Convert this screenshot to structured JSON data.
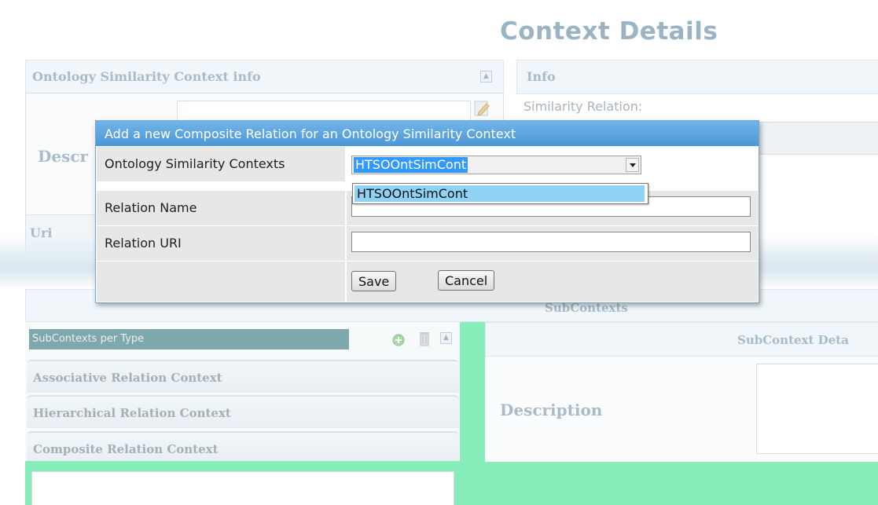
{
  "page": {
    "title": "Context Details",
    "left_panel_header": "Ontology Similarity Context info",
    "description_label": "Descr",
    "uri_label": "Uri",
    "right_panel_header": "Info",
    "similarity_relation_label": "Similarity Relation:",
    "subcontexts_header": "SubContexts"
  },
  "subcontexts": {
    "bar_label": "SubContexts per Type",
    "items": [
      {
        "label": "Associative Relation Context"
      },
      {
        "label": "Hierarchical Relation Context"
      },
      {
        "label": "Composite Relation Context"
      }
    ],
    "detail_header": "SubContext Deta",
    "detail_description_label": "Description"
  },
  "dialog": {
    "title": "Add a new Composite Relation for an Ontology Similarity Context",
    "fields": {
      "contexts_label": "Ontology Similarity Contexts",
      "contexts_selected": "HTSOOntSimCont",
      "contexts_options": [
        "HTSOOntSimCont"
      ],
      "relation_name_label": "Relation Name",
      "relation_name_value": "",
      "relation_uri_label": "Relation URI",
      "relation_uri_value": ""
    },
    "save_label": "Save",
    "cancel_label": "Cancel"
  },
  "colors": {
    "accent_green": "#86edbb",
    "dialog_title_blue": "#4d97d4",
    "selection_blue": "#3399ff"
  },
  "icons": [
    "collapse-icon",
    "edit-icon",
    "add-icon",
    "trash-icon"
  ]
}
